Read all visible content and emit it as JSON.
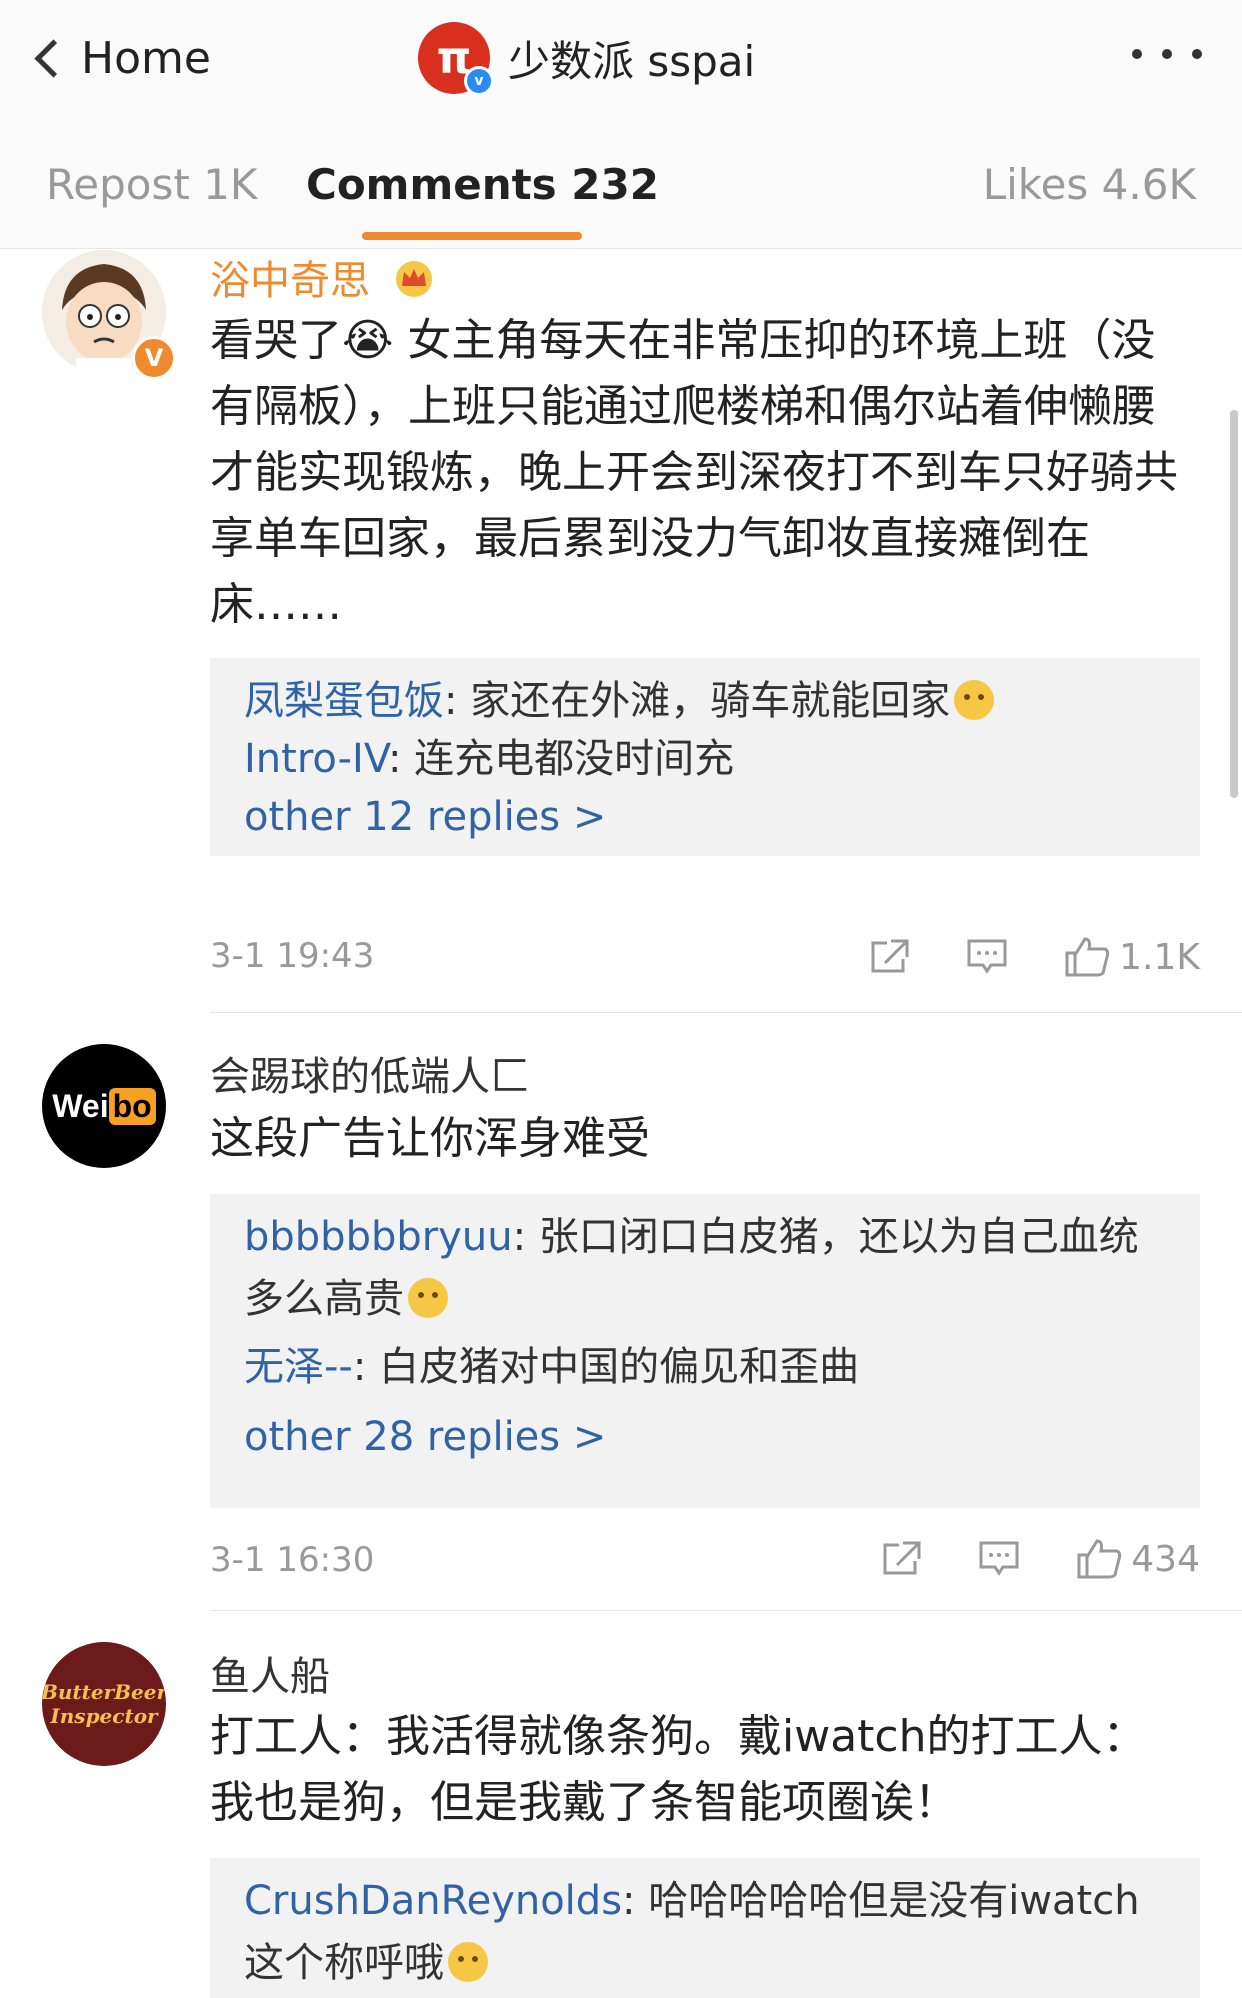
{
  "header": {
    "back_label": "Home",
    "account_logo": "π",
    "account_name": "少数派 sspai",
    "verified_badge": "v"
  },
  "tabs": [
    {
      "label": "Repost 1K"
    },
    {
      "label": "Comments 232"
    },
    {
      "label": "Likes 4.6K"
    }
  ],
  "accent_color": "#f08a2e",
  "link_color": "#2f63a6",
  "comments": [
    {
      "author": "浴中奇思",
      "author_color": "#f08a2e",
      "badge_icon": "crown-icon",
      "verified": "V",
      "text": "看哭了😭 女主角每天在非常压抑的环境上班（没有隔板），上班只能通过爬楼梯和偶尔站着伸懒腰才能实现锻炼，晚上开会到深夜打不到车只好骑共享单车回家，最后累到没力气卸妆直接瘫倒在床……",
      "replies": [
        {
          "name": "凤梨蛋包饭",
          "text": ": 家还在外滩，骑车就能回家"
        },
        {
          "name": "Intro-IV",
          "text": ": 连充电都没时间充"
        }
      ],
      "more_replies": "other 12 replies >",
      "time": "3-1 19:43",
      "likes": "1.1K"
    },
    {
      "author": "会踢球的低端人匚",
      "author_color": "#333333",
      "avatar_text_a": "Wei",
      "avatar_text_b": "bo",
      "text": "这段广告让你浑身难受",
      "replies": [
        {
          "name": "bbbbbbbryuu",
          "text": ": 张口闭口白皮猪，还以为自己血统多么高贵"
        },
        {
          "name": "无泽--",
          "text": ": 白皮猪对中国的偏见和歪曲"
        }
      ],
      "more_replies": "other 28 replies >",
      "time": "3-1 16:30",
      "likes": "434"
    },
    {
      "author": "鱼人船",
      "author_color": "#333333",
      "avatar_text_a": "ButterBeer",
      "avatar_text_b": "Inspector",
      "text": "打工人：我活得就像条狗。戴iwatch的打工人：我也是狗，但是我戴了条智能项圈诶！",
      "replies": [
        {
          "name": "CrushDanReynolds",
          "text": ": 哈哈哈哈哈但是没有iwatch这个称呼哦"
        }
      ]
    }
  ]
}
